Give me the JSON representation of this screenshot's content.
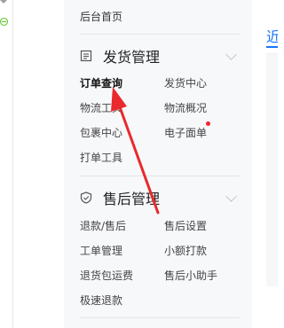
{
  "menu": {
    "home_label": "后台首页",
    "sections": [
      {
        "title": "发货管理",
        "icon": "document-icon",
        "items": [
          "订单查询",
          "发货中心",
          "物流工具",
          "物流概况",
          "包裹中心",
          "电子面单",
          "打单工具"
        ]
      },
      {
        "title": "售后管理",
        "icon": "shield-icon",
        "items": [
          "退款/售后",
          "售后设置",
          "工单管理",
          "小额打款",
          "退货包运费",
          "售后小助手",
          "极速退款"
        ]
      }
    ]
  },
  "content": {
    "title_fragment": "近"
  },
  "colors": {
    "accent": "#1677ff",
    "annotation": "#e8292d",
    "badge": "#f5222d"
  }
}
